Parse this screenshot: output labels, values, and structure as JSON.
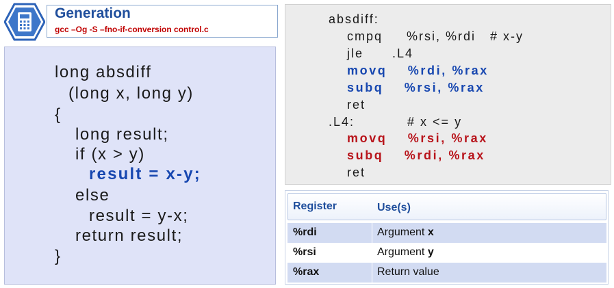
{
  "header": {
    "title": "Generation",
    "subtitle": "gcc –Og -S –fno-if-conversion control.c",
    "icon": "calculator-icon"
  },
  "c_code": {
    "lines": [
      "long absdiff",
      "(long x, long y)",
      "{",
      "long result;",
      "if (x > y)",
      "result = x-y;",
      "else",
      "result = y-x;",
      "return result;",
      "}"
    ]
  },
  "assembly": {
    "lines": [
      "absdiff:",
      "cmpq     %rsi, %rdi   # x-y",
      "jle      .L4",
      "movq    %rdi, %rax",
      "subq    %rsi, %rax",
      "ret",
      ".L4:           # x <= y",
      "movq    %rsi, %rax",
      "subq    %rdi, %rax",
      "ret"
    ]
  },
  "register_table": {
    "headers": [
      "Register",
      "Use(s)"
    ],
    "rows": [
      {
        "register": "%rdi",
        "use_prefix": "Argument ",
        "use_bold": "x"
      },
      {
        "register": "%rsi",
        "use_prefix": "Argument ",
        "use_bold": "y"
      },
      {
        "register": "%rax",
        "use_prefix": "Return value",
        "use_bold": ""
      }
    ]
  },
  "colors": {
    "title_blue": "#1f4e9c",
    "subtitle_red": "#c00000",
    "highlight_blue": "#1747b0",
    "highlight_red": "#b8141b",
    "c_panel_bg": "#dfe3f8",
    "asm_panel_bg": "#ececec",
    "table_shade": "#d2dbf2"
  }
}
